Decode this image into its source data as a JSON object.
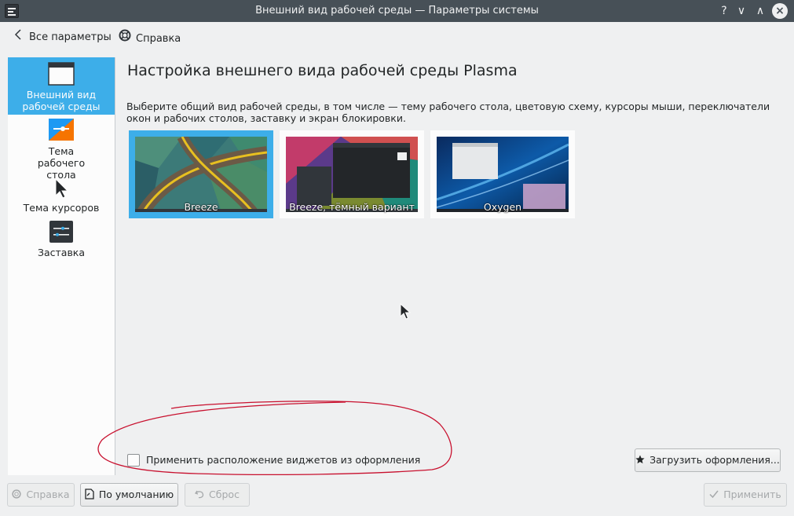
{
  "window": {
    "title": "Внешний вид рабочей среды — Параметры системы",
    "controls": [
      "?",
      "∨",
      "∧",
      "×"
    ]
  },
  "toolbar": {
    "back_label": "Все параметры",
    "help_label": "Справка"
  },
  "sidebar": {
    "items": [
      {
        "label": "Внешний вид рабочей среды",
        "icon": "window-icon",
        "active": true
      },
      {
        "label": "Тема рабочего стола",
        "icon": "desktop-theme-icon",
        "active": false
      },
      {
        "label": "Тема курсоров",
        "icon": "cursor-icon",
        "active": false
      },
      {
        "label": "Заставка",
        "icon": "splash-screen-icon",
        "active": false
      }
    ]
  },
  "main": {
    "title": "Настройка внешнего вида рабочей среды Plasma",
    "description": "Выберите общий вид рабочей среды, в том числе — тему рабочего стола, цветовую схему, курсоры мыши, переключатели окон и рабочих столов, заставку и экран блокировки.",
    "themes": [
      {
        "name": "Breeze",
        "selected": true
      },
      {
        "name": "Breeze, тёмный вариант",
        "selected": false
      },
      {
        "name": "Oxygen",
        "selected": false
      }
    ],
    "use_layout_checkbox": {
      "label": "Применить расположение виджетов из оформления",
      "checked": false
    },
    "get_new_label": "Загрузить оформления..."
  },
  "footer": {
    "help_label": "Справка",
    "defaults_label": "По умолчанию",
    "reset_label": "Сброс",
    "apply_label": "Применить"
  },
  "colors": {
    "accent": "#3daee9",
    "titlebar": "#475057",
    "window_bg": "#eff0f1",
    "annotation": "#c8102e"
  }
}
